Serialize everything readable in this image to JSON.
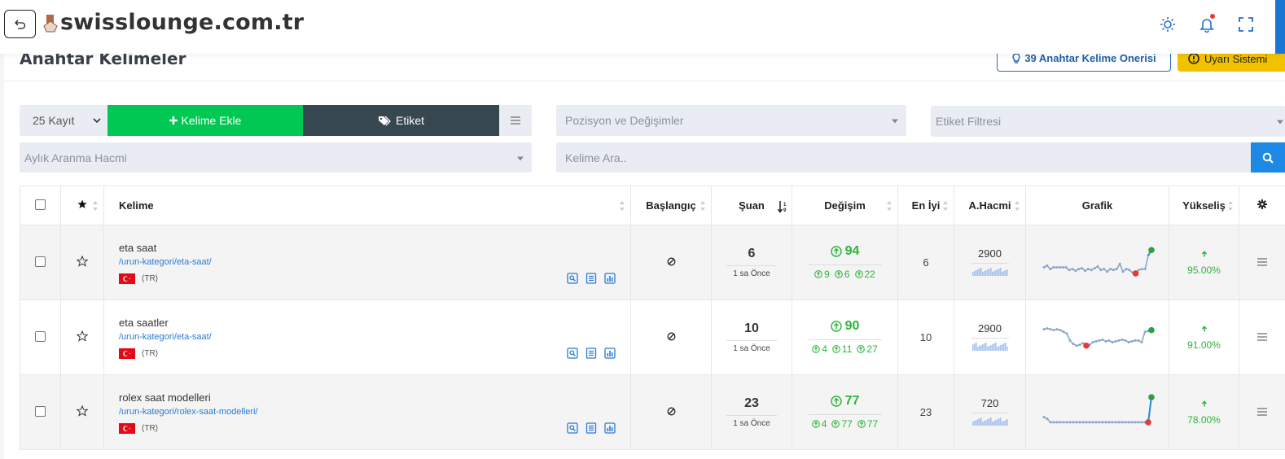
{
  "header": {
    "site_title": "swisslounge.com.tr"
  },
  "page": {
    "title": "Anahtar Kelimeler",
    "suggest_label": "39 Anahtar Kelime Önerisi",
    "alert_label": "Uyarı Sistemi"
  },
  "filters": {
    "record_count": "25 Kayıt",
    "add_keyword": "Kelime Ekle",
    "tag": "Etiket",
    "position_filter": "Pozisyon ve Değişimler",
    "tag_filter": "Etiket Filtresi",
    "volume_filter": "Aylık Aranma Hacmi",
    "search_placeholder": "Kelime Ara.."
  },
  "table": {
    "columns": [
      "Kelime",
      "Başlangıç",
      "Şuan",
      "Değişim",
      "En İyi",
      "A.Hacmi",
      "Grafik",
      "Yükseliş"
    ],
    "rows": [
      {
        "keyword": "eta saat",
        "url": "/urun-kategori/eta-saat/",
        "geo": "(TR)",
        "current": "6",
        "time": "1 sa Önce",
        "change": "94",
        "sub1": "9",
        "sub2": "6",
        "sub3": "22",
        "best": "6",
        "volume": "2900",
        "rise": "95.00%",
        "trend": [
          24,
          22,
          26,
          24,
          24,
          24,
          24,
          24,
          27,
          26,
          28,
          26,
          25,
          28,
          26,
          27,
          25,
          23,
          27,
          26,
          29,
          26,
          27,
          26,
          20,
          29,
          26,
          27,
          30,
          31,
          27,
          26,
          26,
          10,
          4
        ]
      },
      {
        "keyword": "eta saatler",
        "url": "/urun-kategori/eta-saat/",
        "geo": "(TR)",
        "current": "10",
        "time": "1 sa Önce",
        "change": "90",
        "sub1": "4",
        "sub2": "11",
        "sub3": "27",
        "best": "10",
        "volume": "2900",
        "rise": "91.00%",
        "trend": [
          9,
          8,
          9,
          10,
          9,
          10,
          12,
          14,
          22,
          26,
          28,
          27,
          25,
          28,
          27,
          24,
          23,
          22,
          21,
          23,
          22,
          24,
          23,
          22,
          21,
          22,
          24,
          23,
          22,
          22,
          24,
          12,
          11,
          10
        ]
      },
      {
        "keyword": "rolex saat modelleri",
        "url": "/urun-kategori/rolex-saat-modelleri/",
        "geo": "(TR)",
        "current": "23",
        "time": "1 sa Önce",
        "change": "77",
        "sub1": "4",
        "sub2": "77",
        "sub3": "77",
        "best": "23",
        "volume": "720",
        "rise": "78.00%",
        "trend": [
          24,
          26,
          30,
          30,
          30,
          30,
          30,
          30,
          30,
          30,
          30,
          30,
          30,
          30,
          30,
          30,
          30,
          30,
          30,
          30,
          30,
          30,
          30,
          30,
          30,
          30,
          30,
          30,
          30,
          30,
          30,
          30,
          30,
          1
        ]
      }
    ]
  },
  "colors": {
    "green": "#00c853",
    "dark": "#37474f",
    "blue": "#1e88e5",
    "yellow": "#f2c200",
    "change_green": "#2bb539"
  }
}
